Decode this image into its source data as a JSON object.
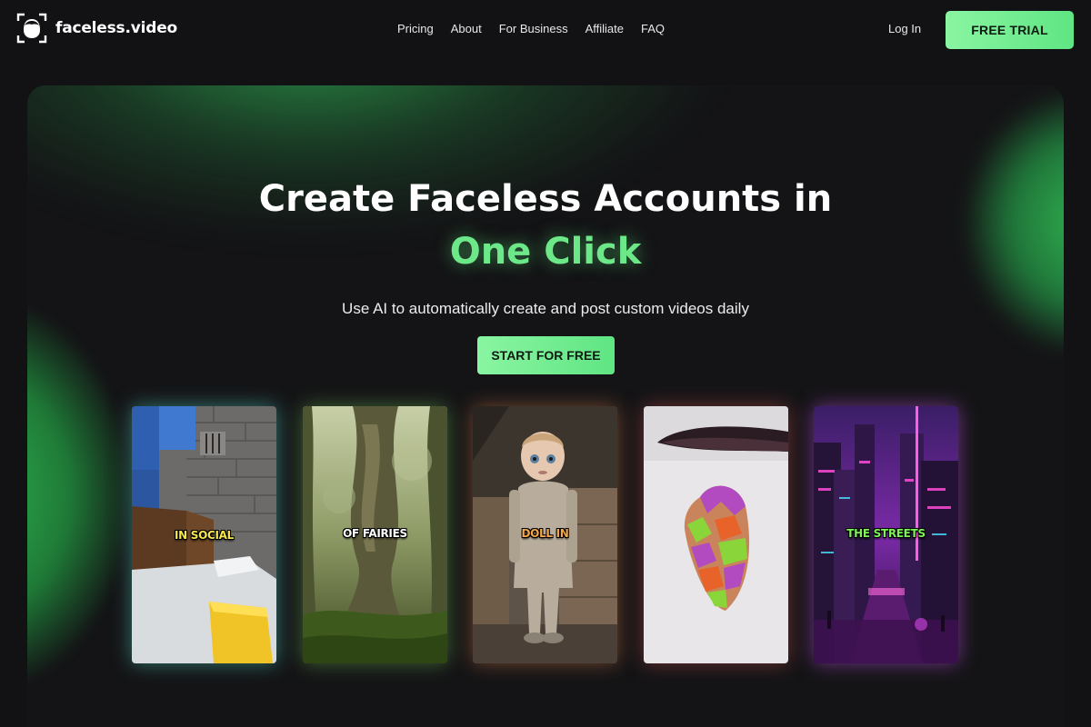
{
  "brand": {
    "name": "faceless.video",
    "logo_icon": "face-outline-icon"
  },
  "nav": {
    "links": [
      "Pricing",
      "About",
      "For Business",
      "Affiliate",
      "FAQ"
    ]
  },
  "header": {
    "login_label": "Log In",
    "trial_label": "FREE TRIAL"
  },
  "hero": {
    "headline": "Create Faceless Accounts in",
    "headline_accent": "One Click",
    "subtitle": "Use AI to automatically create and post custom videos daily",
    "cta_label": "START FOR FREE"
  },
  "cards": [
    {
      "caption": "IN SOCIAL",
      "caption_color": "#f6e84a",
      "scene": "minecraft-parkour"
    },
    {
      "caption": "OF FAIRIES",
      "caption_color": "#ffffff",
      "scene": "mossy-forest"
    },
    {
      "caption": "DOLL IN",
      "caption_color": "#f3a64a",
      "scene": "creepy-doll"
    },
    {
      "caption": "",
      "caption_color": "#ffffff",
      "scene": "kinetic-sand-cutting"
    },
    {
      "caption": "THE STREETS",
      "caption_color": "#7ef25a",
      "scene": "neon-cyberpunk-city"
    }
  ],
  "colors": {
    "background": "#121214",
    "accent": "#6ce889",
    "button_gradient_start": "#8af5a2",
    "button_gradient_end": "#5fe583"
  }
}
